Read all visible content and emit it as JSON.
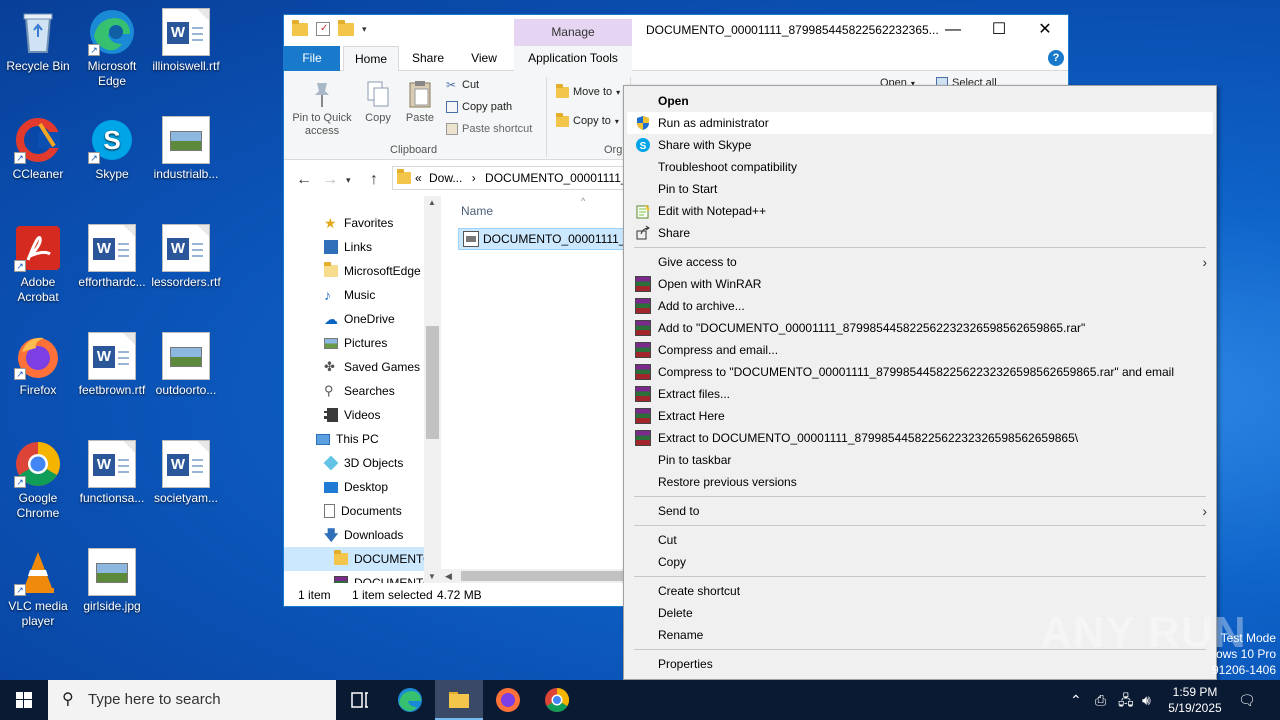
{
  "desktop": {
    "icons": [
      {
        "label": "Recycle Bin"
      },
      {
        "label": "Microsoft Edge"
      },
      {
        "label": "illinoiswell.rtf"
      },
      {
        "label": "CCleaner"
      },
      {
        "label": "Skype"
      },
      {
        "label": "industrialb..."
      },
      {
        "label": "Adobe Acrobat"
      },
      {
        "label": "efforthardc..."
      },
      {
        "label": "lessorders.rtf"
      },
      {
        "label": "Firefox"
      },
      {
        "label": "feetbrown.rtf"
      },
      {
        "label": "outdoorto..."
      },
      {
        "label": "Google Chrome"
      },
      {
        "label": "functionsa..."
      },
      {
        "label": "societyam..."
      },
      {
        "label": "VLC media player"
      },
      {
        "label": "girlside.jpg"
      }
    ]
  },
  "explorer": {
    "title": "DOCUMENTO_00001111_879985445822562232365...",
    "manage_tab": "Manage",
    "tabs": {
      "file": "File",
      "home": "Home",
      "share": "Share",
      "view": "View",
      "app_tools": "Application Tools"
    },
    "ribbon": {
      "pin_quick_access": "Pin to Quick access",
      "copy": "Copy",
      "paste": "Paste",
      "cut": "Cut",
      "copy_path": "Copy path",
      "paste_shortcut": "Paste shortcut",
      "clipboard_group": "Clipboard",
      "move_to": "Move to",
      "copy_to": "Copy to",
      "organize_group": "Org",
      "open": "Open",
      "select_all": "Select all"
    },
    "address": {
      "ellipsis": "«",
      "part1": "Dow...",
      "part2": "DOCUMENTO_00001111_87"
    },
    "nav": [
      {
        "label": "Favorites"
      },
      {
        "label": "Links"
      },
      {
        "label": "MicrosoftEdge"
      },
      {
        "label": "Music"
      },
      {
        "label": "OneDrive"
      },
      {
        "label": "Pictures"
      },
      {
        "label": "Saved Games"
      },
      {
        "label": "Searches"
      },
      {
        "label": "Videos"
      },
      {
        "label": "This PC"
      },
      {
        "label": "3D Objects"
      },
      {
        "label": "Desktop"
      },
      {
        "label": "Documents"
      },
      {
        "label": "Downloads"
      },
      {
        "label": "DOCUMENTO"
      },
      {
        "label": "DOCUMENTO"
      }
    ],
    "column_name": "Name",
    "file_name": "DOCUMENTO_00001111_87",
    "status": {
      "count": "1 item",
      "selected": "1 item selected",
      "size": "4.72 MB"
    }
  },
  "context_menu": {
    "items": [
      "Open",
      "Run as administrator",
      "Share with Skype",
      "Troubleshoot compatibility",
      "Pin to Start",
      "Edit with Notepad++",
      "Share",
      "Give access to",
      "Open with WinRAR",
      "Add to archive...",
      "Add to \"DOCUMENTO_00001111_879985445822562232326598562659865.rar\"",
      "Compress and email...",
      "Compress to \"DOCUMENTO_00001111_879985445822562232326598562659865.rar\" and email",
      "Extract files...",
      "Extract Here",
      "Extract to DOCUMENTO_00001111_879985445822562232326598562659865\\",
      "Pin to taskbar",
      "Restore previous versions",
      "Send to",
      "Cut",
      "Copy",
      "Create shortcut",
      "Delete",
      "Rename",
      "Properties"
    ]
  },
  "watermark": "ANY RUN",
  "test_mode": {
    "line1": "Test Mode",
    "line2": "ows 10 Pro",
    "line3": "91206-1406"
  },
  "taskbar": {
    "search_placeholder": "Type here to search",
    "time": "1:59 PM",
    "date": "5/19/2025"
  },
  "colors": {
    "accent": "#1979ca",
    "desktop": "#0e63c9",
    "taskbar": "#0b1a33",
    "manage": "#e6d5f2"
  }
}
